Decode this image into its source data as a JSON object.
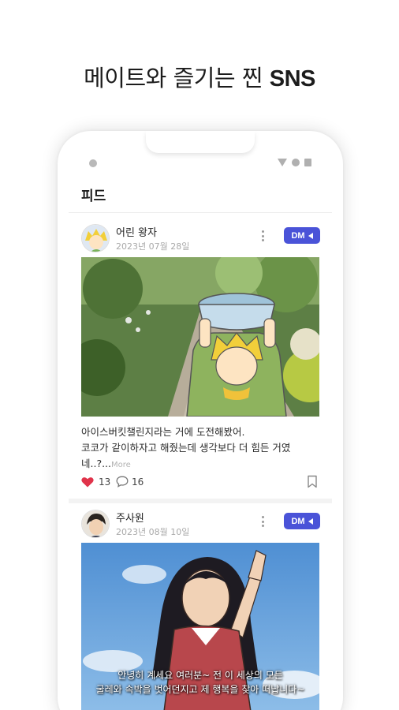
{
  "headline": {
    "text": "메이트와 즐기는 찐 ",
    "bold": "SNS"
  },
  "screen": {
    "title": "피드"
  },
  "posts": [
    {
      "username": "어린 왕자",
      "date": "2023년 07월 28일",
      "dm_label": "DM",
      "caption_lines": [
        "아이스버킷챌린지라는 거에 도전해봤어.",
        "코코가 같이하자고 해줬는데 생각보다 더 힘든 거였",
        "네..?..."
      ],
      "more_label": "More",
      "likes": "13",
      "comments": "16",
      "liked": true
    },
    {
      "username": "주사원",
      "date": "2023년 08월 10일",
      "dm_label": "DM",
      "image_subtitle_lines": [
        "안녕히 계세요 여러분~ 전 이 세상의 모든",
        "굴레와 속박을 벗어던지고 제 행복을 찾아 떠납니다~"
      ]
    }
  ],
  "colors": {
    "accent": "#4a53d8",
    "like": "#e0334a"
  },
  "icons": [
    "more-vertical-icon",
    "paper-plane-icon",
    "heart-icon",
    "comment-icon",
    "bookmark-icon"
  ]
}
